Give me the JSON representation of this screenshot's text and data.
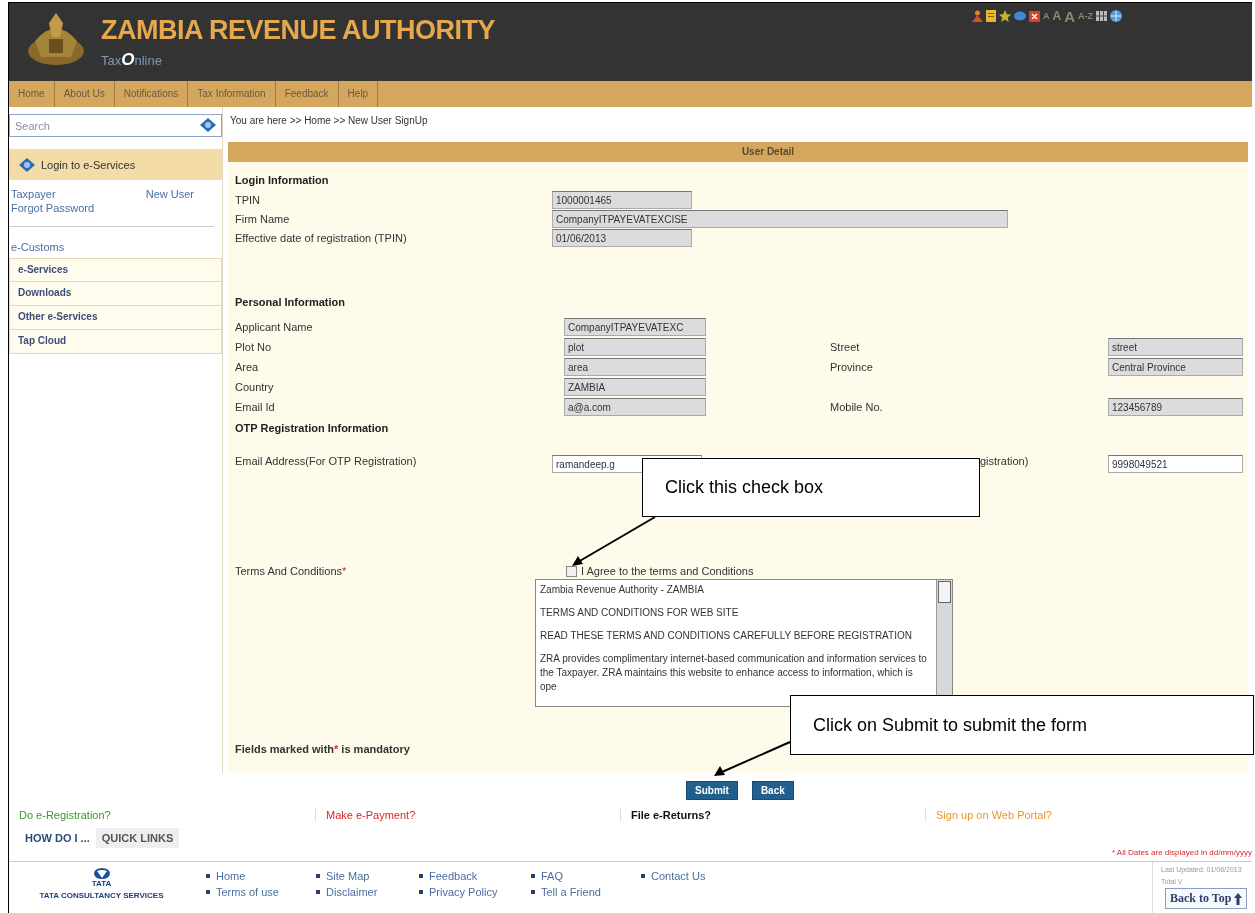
{
  "header": {
    "title": "ZAMBIA REVENUE AUTHORITY",
    "subtitle": "Tax**O**nline",
    "tools": [
      {
        "kind": "icon"
      },
      {
        "kind": "icon"
      },
      {
        "kind": "icon"
      },
      {
        "kind": "icon"
      },
      {
        "kind": "icon"
      },
      {
        "kind": "text",
        "label": "A"
      },
      {
        "kind": "text",
        "label": "A"
      },
      {
        "kind": "text",
        "label": "A"
      },
      {
        "kind": "text",
        "label": "A-Z"
      },
      {
        "kind": "icon"
      },
      {
        "kind": "icon"
      }
    ]
  },
  "nav": [
    {
      "label": "Home"
    },
    {
      "label": "About Us"
    },
    {
      "label": "Notifications"
    },
    {
      "label": "Tax Information"
    },
    {
      "label": "Feedback"
    },
    {
      "label": "Help"
    }
  ],
  "sidebar": {
    "search": {
      "placeholder": "Search"
    },
    "login_title": "Login to e-Services",
    "login_links": [
      "Taxpayer",
      "New User"
    ],
    "forgot": "Forgot Password",
    "items": [
      {
        "label": "e-Customs",
        "kind": "link"
      },
      {
        "label": "e-Services",
        "kind": "menu"
      },
      {
        "label": "Downloads",
        "kind": "menu"
      },
      {
        "label": "Other e-Services",
        "kind": "menu"
      },
      {
        "label": "Tap Cloud",
        "kind": "menu"
      }
    ]
  },
  "breadcrumb": "You are here >> Home >> New User SignUp",
  "panel_title": "User Detail",
  "login": {
    "heading": "Login Information",
    "fields": [
      {
        "label": "TPIN",
        "value": "1000001465",
        "kind": "short"
      },
      {
        "label": "Firm Name",
        "value": "CompanyITPAYEVATEXCISE",
        "kind": "wide"
      },
      {
        "label": "Effective date of registration (TPIN)",
        "value": "01/06/2013",
        "kind": "short"
      }
    ]
  },
  "personal": {
    "heading": "Personal Information",
    "rows": [
      {
        "label": "Applicant Name",
        "value": "CompanyITPAYEVATEXC"
      },
      {
        "label": "Plot No",
        "value": "plot",
        "label_2": "Street",
        "value_2": "street"
      },
      {
        "label": "Area",
        "value": "area",
        "label_2": "Province",
        "value_2": "Central Province"
      },
      {
        "label": "Country",
        "value": "ZAMBIA"
      },
      {
        "label": "Email Id",
        "value": "a@a.com",
        "label_2": "Mobile No.",
        "value_2": "123456789"
      }
    ]
  },
  "otp": {
    "heading": "OTP Registration Information",
    "label": "Email Address(For OTP Registration)",
    "value": "ramandeep.g",
    "label_2": "gistration)",
    "value_2": "9998049521"
  },
  "terms": {
    "label": "Terms And Conditions",
    "mark": "*",
    "agree_label": "I Agree to the terms and Conditions",
    "agreed": false,
    "paragraphs": [
      "Zambia Revenue Authority - ZAMBIA",
      "TERMS AND CONDITIONS FOR WEB SITE",
      "READ THESE TERMS AND CONDITIONS CAREFULLY BEFORE REGISTRATION",
      "ZRA provides complimentary internet-based communication and information services to the Taxpayer. ZRA maintains this website to enhance access to information, which is ope"
    ]
  },
  "mandatory": {
    "lead": "Fields marked with",
    "mark": "*",
    "tail": " is mandatory"
  },
  "buttons": [
    "Submit",
    "Back"
  ],
  "quick_links": [
    {
      "label": "Do e-Registration?",
      "color": "#3c9a2e"
    },
    {
      "label": "Make e-Payment?",
      "color": "#d9262b"
    },
    {
      "label": "File e-Returns?",
      "color": "#111111"
    },
    {
      "label": "Sign up on Web Portal?",
      "color": "#e8962e"
    }
  ],
  "tabs": [
    {
      "label": "HOW DO I ...",
      "selected": true
    },
    {
      "label": "QUICK LINKS",
      "selected": false
    }
  ],
  "date_note": "* All Dates are displayed in dd/mm/yyyy",
  "footer": {
    "logo_word": "TATA",
    "company": "TATA CONSULTANCY SERVICES",
    "link_columns": [
      [
        "Home",
        "Terms of use"
      ],
      [
        "Site Map",
        "Disclaimer"
      ],
      [
        "Feedback",
        "Privacy Policy"
      ],
      [
        "FAQ",
        "Tell a Friend"
      ],
      [
        "Contact Us"
      ]
    ],
    "last_updated": "Last Updated: 01/06/2013",
    "visits": "Total V",
    "back_to_top": "Back to Top"
  },
  "callouts": [
    {
      "text": "Click this check box"
    },
    {
      "text": "Click on Submit to submit the form"
    }
  ]
}
